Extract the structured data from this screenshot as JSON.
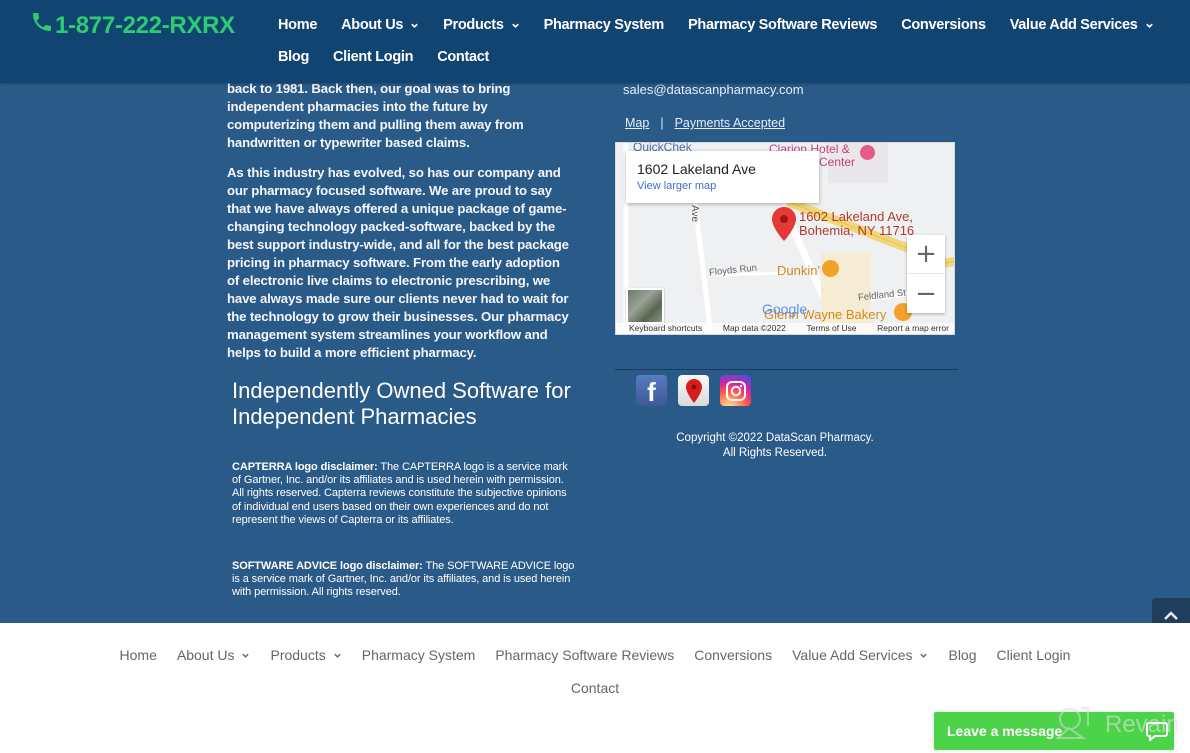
{
  "header": {
    "phone": "1-877-222-RXRX",
    "phone_icon": "phone-icon",
    "nav_row1": [
      {
        "label": "Home",
        "dropdown": false
      },
      {
        "label": "About Us",
        "dropdown": true
      },
      {
        "label": "Products",
        "dropdown": true
      },
      {
        "label": "Pharmacy System",
        "dropdown": false
      },
      {
        "label": "Pharmacy Software Reviews",
        "dropdown": false
      },
      {
        "label": "Conversions",
        "dropdown": false
      },
      {
        "label": "Value Add Services",
        "dropdown": true
      }
    ],
    "nav_row2": [
      {
        "label": "Blog"
      },
      {
        "label": "Client Login"
      },
      {
        "label": "Contact"
      }
    ]
  },
  "about": {
    "paragraph1": "back to 1981. Back then, our goal was to bring independent pharmacies into the future by computerizing them and pulling them away from handwritten or typewriter based claims.",
    "paragraph2": "As this industry has evolved, so has our company and our pharmacy focused software. We are proud to say that we have always offered a unique package of game-changing technology packed-software, backed by the best support industry-wide, and all for the best package pricing in pharmacy software. From the early adoption of electronic live claims to electronic prescribing, we have always made sure our clients never had to wait for the technology to grow their businesses. Our pharmacy management system streamlines your workflow and helps to build a more efficient pharmacy.",
    "tagline": "Independently Owned Software for Independent Pharmacies"
  },
  "disclaimers": [
    {
      "title": "CAPTERRA logo disclaimer:",
      "text": " The CAPTERRA logo is a service mark of Gartner, Inc. and/or its affiliates and is used herein with permission. All rights reserved. Capterra reviews constitute the subjective opinions of individual end users based on their own experiences and do not represent the views of Capterra or its affiliates."
    },
    {
      "title": "SOFTWARE ADVICE logo disclaimer:",
      "text": " The SOFTWARE ADVICE logo is a service mark of Gartner, Inc. and/or its affiliates, and is used herein with permission. All rights reserved."
    }
  ],
  "contact": {
    "email": "sales@datascanpharmacy.com",
    "map_link": "Map",
    "separator": "|",
    "payments_link": "Payments Accepted"
  },
  "map": {
    "card_title": "1602 Lakeland Ave",
    "card_link": "View larger map",
    "pin_label_line1": "1602 Lakeland Ave,",
    "pin_label_line2": "Bohemia, NY 11716",
    "places": {
      "quickchek": "QuickChek",
      "clarion1": "Clarion Hotel &",
      "clarion2": "Center",
      "ave": "Ave",
      "floyds": "Floyds Run",
      "dunkin": "Dunkin'",
      "feldland": "Feldland St",
      "bakery": "Glenn Wayne Bakery",
      "google": "Google"
    },
    "zoom_in": "+",
    "zoom_out": "−",
    "footer": {
      "shortcuts": "Keyboard shortcuts",
      "data": "Map data ©2022",
      "terms": "Terms of Use",
      "report": "Report a map error"
    }
  },
  "social": [
    {
      "name": "facebook",
      "glyph": "f"
    },
    {
      "name": "google-maps"
    },
    {
      "name": "instagram"
    }
  ],
  "copyright": {
    "line1": "Copyright ©2022 DataScan Pharmacy.",
    "line2": "All Rights Reserved."
  },
  "footer_nav": {
    "row1": [
      {
        "label": "Home",
        "dropdown": false
      },
      {
        "label": "About Us",
        "dropdown": true
      },
      {
        "label": "Products",
        "dropdown": true
      },
      {
        "label": "Pharmacy System",
        "dropdown": false
      },
      {
        "label": "Pharmacy Software Reviews",
        "dropdown": false
      },
      {
        "label": "Conversions",
        "dropdown": false
      },
      {
        "label": "Value Add Services",
        "dropdown": true
      },
      {
        "label": "Blog",
        "dropdown": false
      },
      {
        "label": "Client Login",
        "dropdown": false
      }
    ],
    "row2": [
      {
        "label": "Contact"
      }
    ]
  },
  "chat": {
    "label": "Leave a message",
    "watermark": "Revain"
  },
  "colors": {
    "header_bg": "#124472",
    "body_bg": "#2a5a87",
    "phone_green": "#2ecc71",
    "chat_green": "#4cd34a"
  }
}
